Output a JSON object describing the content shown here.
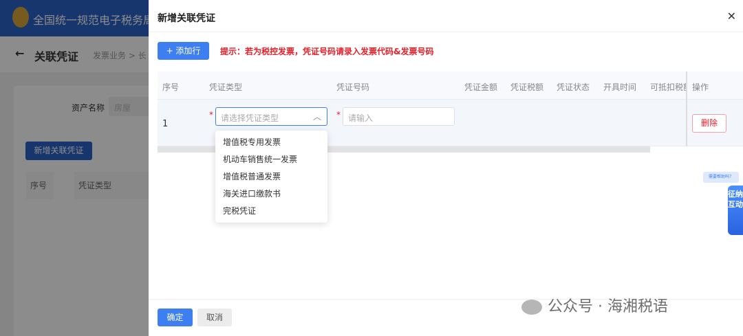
{
  "background": {
    "site_title": "全国统一规范电子税务局",
    "page_title": "关联凭证",
    "breadcrumb": "发票业务 > 长",
    "asset_label": "资产名称",
    "asset_value": "房屋",
    "add_button": "新增关联凭证",
    "columns": [
      "序号",
      "凭证类型"
    ]
  },
  "dialog": {
    "title": "新增关联凭证",
    "close_icon": "close-icon",
    "add_row": "+ 添加行",
    "tip": "提示：若为税控发票，凭证号码请录入发票代码&发票号码",
    "columns": [
      "序号",
      "凭证类型",
      "凭证号码",
      "凭证金额",
      "凭证税额",
      "凭证状态",
      "开具时间",
      "可抵扣税额",
      "操作"
    ],
    "row": {
      "index": "1",
      "type_placeholder": "请选择凭证类型",
      "number_placeholder": "请输入",
      "delete": "删除"
    },
    "dropdown_options": [
      "增值税专用发票",
      "机动车销售统一发票",
      "增值税普通发票",
      "海关进口缴款书",
      "完税凭证"
    ],
    "ok": "确定",
    "cancel": "取消"
  },
  "help": {
    "bubble": "需要帮助吗？",
    "tab": "征纳互动"
  },
  "watermark": "公众号 · 海湘税语",
  "colors": {
    "primary": "#3d7ef0",
    "danger": "#e8202a"
  }
}
